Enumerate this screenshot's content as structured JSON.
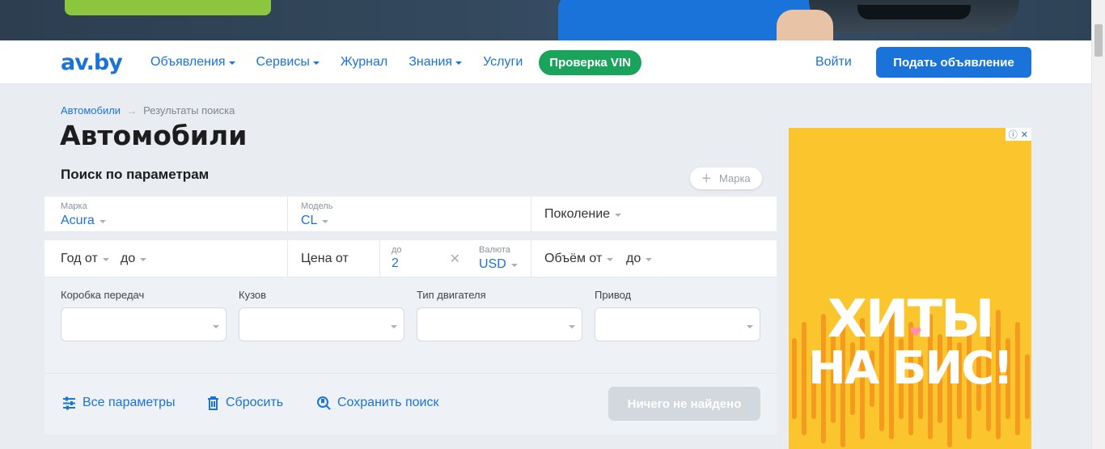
{
  "navbar": {
    "logo": "av.by",
    "items": [
      {
        "label": "Объявления",
        "dropdown": true
      },
      {
        "label": "Сервисы",
        "dropdown": true
      },
      {
        "label": "Журнал",
        "dropdown": false
      },
      {
        "label": "Знания",
        "dropdown": true
      },
      {
        "label": "Услуги",
        "dropdown": false
      }
    ],
    "vin_button": "Проверка VIN",
    "login": "Войти",
    "post_ad": "Подать объявление"
  },
  "breadcrumb": {
    "root": "Автомобили",
    "current": "Результаты поиска"
  },
  "page_title": "Автомобили",
  "section_title": "Поиск по параметрам",
  "add_brand_label": "Марка",
  "filters": {
    "brand": {
      "label": "Марка",
      "value": "Acura"
    },
    "model": {
      "label": "Модель",
      "value": "CL"
    },
    "generation": {
      "placeholder": "Поколение"
    },
    "year_from": "Год от",
    "year_to": "до",
    "price_from": "Цена от",
    "price_to": {
      "label": "до",
      "value": "2"
    },
    "currency": {
      "label": "Валюта",
      "value": "USD"
    },
    "volume_from": "Объём от",
    "volume_to": "до",
    "transmission_label": "Коробка передач",
    "body_label": "Кузов",
    "engine_label": "Тип двигателя",
    "drive_label": "Привод"
  },
  "actions": {
    "all_params": "Все параметры",
    "reset": "Сбросить",
    "save_search": "Сохранить поиск",
    "search_result": "Ничего не найдено"
  },
  "ad": {
    "line1": "ХИТЫ",
    "line2": "НА БИС!"
  },
  "colors": {
    "brand_blue": "#1a73d9",
    "vin_green": "#1aa35a",
    "ad_yellow": "#fbc52d"
  }
}
